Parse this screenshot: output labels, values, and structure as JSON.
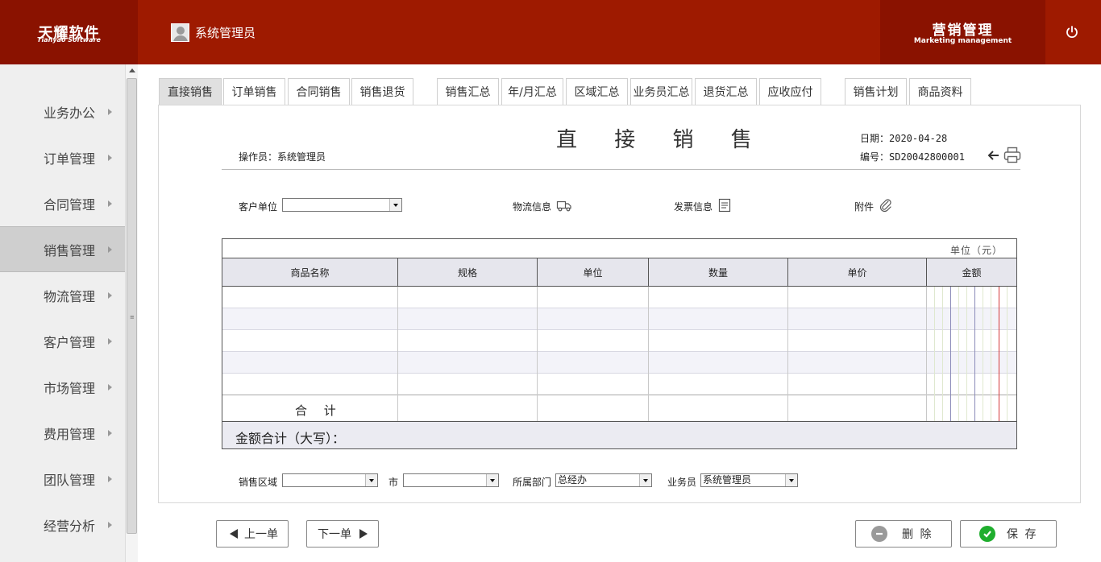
{
  "header": {
    "logo_cn": "天耀软件",
    "logo_en": "Tianyao Software",
    "user_name": "系统管理员",
    "module_cn": "营销管理",
    "module_en": "Marketing management",
    "colors": {
      "primary": "#9e1a00",
      "dark": "#8a1200"
    }
  },
  "sidebar": {
    "items": [
      {
        "label": "业务办公"
      },
      {
        "label": "订单管理"
      },
      {
        "label": "合同管理"
      },
      {
        "label": "销售管理",
        "active": true
      },
      {
        "label": "物流管理"
      },
      {
        "label": "客户管理"
      },
      {
        "label": "市场管理"
      },
      {
        "label": "费用管理"
      },
      {
        "label": "团队管理"
      },
      {
        "label": "经营分析"
      }
    ]
  },
  "tabs": [
    {
      "label": "直接销售",
      "active": true
    },
    {
      "label": "订单销售"
    },
    {
      "label": "合同销售"
    },
    {
      "label": "销售退货"
    },
    {
      "label": "销售汇总"
    },
    {
      "label": "年/月汇总"
    },
    {
      "label": "区域汇总"
    },
    {
      "label": "业务员汇总"
    },
    {
      "label": "退货汇总"
    },
    {
      "label": "应收应付"
    },
    {
      "label": "销售计划"
    },
    {
      "label": "商品资料"
    }
  ],
  "form": {
    "title": "直 接 销 售",
    "operator": "操作员：系统管理员",
    "date": "日期：2020-04-28",
    "number": "编号：SD20042800001",
    "customer_label": "客户单位",
    "customer_value": "",
    "logistics_label": "物流信息",
    "invoice_label": "发票信息",
    "attachment_label": "附件",
    "unit_label": "单位（元）",
    "columns": [
      "商品名称",
      "规格",
      "单位",
      "数量",
      "单价",
      "金额"
    ],
    "rows": [
      [
        "",
        "",
        "",
        "",
        "",
        ""
      ],
      [
        "",
        "",
        "",
        "",
        "",
        ""
      ],
      [
        "",
        "",
        "",
        "",
        "",
        ""
      ],
      [
        "",
        "",
        "",
        "",
        "",
        ""
      ],
      [
        "",
        "",
        "",
        "",
        "",
        ""
      ]
    ],
    "total_label": "合 计",
    "caps_total_label": "金额合计（大写）：",
    "region_label": "销售区域",
    "region_value": "",
    "city_label": "市",
    "city_value": "",
    "dept_label": "所属部门",
    "dept_value": "总经办",
    "salesman_label": "业务员",
    "salesman_value": "系统管理员"
  },
  "buttons": {
    "prev": "上一单",
    "next": "下一单",
    "delete": "删 除",
    "save": "保 存"
  },
  "icons": {
    "logistics": "truck-icon",
    "invoice": "document-icon",
    "attachment": "paperclip-icon",
    "back": "arrow-left-icon",
    "print": "printer-icon",
    "power": "power-icon",
    "delete": "minus-circle-icon",
    "save": "check-circle-icon"
  }
}
